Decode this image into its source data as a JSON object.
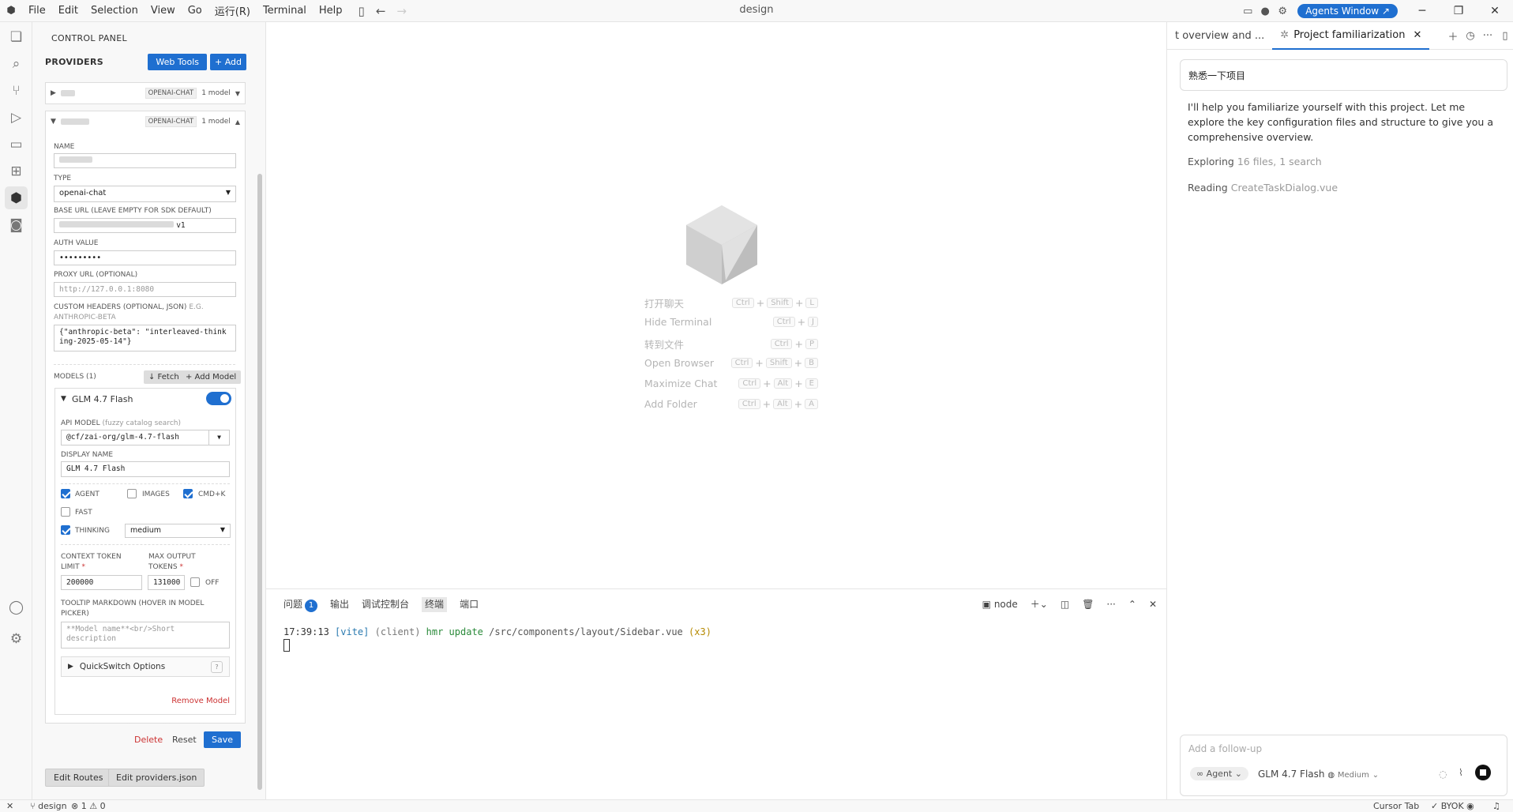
{
  "titlebar": {
    "menu": [
      "File",
      "Edit",
      "Selection",
      "View",
      "Go",
      "运行(R)",
      "Terminal",
      "Help"
    ],
    "title": "design",
    "agents_window": "Agents Window"
  },
  "panel": {
    "title": "CONTROL PANEL",
    "providers_title": "PROVIDERS",
    "web_tools": "Web Tools",
    "add": "+ Add",
    "provider1": {
      "type_tag": "OPENAI-CHAT",
      "count": "1 model"
    },
    "provider2": {
      "type_tag": "OPENAI-CHAT",
      "count": "1 model"
    },
    "name_label": "NAME",
    "type_label": "TYPE",
    "type_value": "openai-chat",
    "base_url_label": "BASE URL (LEAVE EMPTY FOR SDK DEFAULT)",
    "base_url_suffix": "v1",
    "auth_label": "AUTH VALUE",
    "auth_value": "•••••••••",
    "proxy_label": "PROXY URL (OPTIONAL)",
    "proxy_placeholder": "http://127.0.0.1:8080",
    "headers_label": "CUSTOM HEADERS (OPTIONAL, JSON)",
    "headers_hint": "E.G. ANTHROPIC-BETA",
    "headers_value": "{\"anthropic-beta\": \"interleaved-thinking-2025-05-14\"}",
    "models_label": "MODELS (1)",
    "fetch": "↓ Fetch",
    "add_model": "+ Add Model",
    "model": {
      "name": "GLM 4.7 Flash",
      "api_model_label": "API MODEL",
      "api_model_hint": "(fuzzy catalog search)",
      "api_model_value": "@cf/zai-org/glm-4.7-flash",
      "display_label": "DISPLAY NAME",
      "display_value": "GLM 4.7 Flash",
      "agent": "AGENT",
      "images": "IMAGES",
      "cmdk": "CMD+K",
      "fast": "FAST",
      "thinking": "THINKING",
      "thinking_value": "medium",
      "ctx_label1": "CONTEXT TOKEN",
      "ctx_label2": "LIMIT",
      "ctx_value": "200000",
      "max_label1": "MAX OUTPUT",
      "max_label2": "TOKENS",
      "max_value": "131000",
      "off": "OFF",
      "tooltip_label": "TOOLTIP MARKDOWN (HOVER IN MODEL PICKER)",
      "tooltip_placeholder": "**Model name**<br/>Short description",
      "quickswitch": "QuickSwitch Options",
      "remove": "Remove Model"
    },
    "delete": "Delete",
    "reset": "Reset",
    "save": "Save",
    "edit_routes": "Edit Routes",
    "edit_providers": "Edit providers.json"
  },
  "editor": {
    "shortcuts": [
      {
        "label": "打开聊天",
        "keys": [
          "Ctrl",
          "Shift",
          "L"
        ]
      },
      {
        "label": "Hide Terminal",
        "keys": [
          "Ctrl",
          "J"
        ]
      },
      {
        "label": "转到文件",
        "keys": [
          "Ctrl",
          "P"
        ]
      },
      {
        "label": "Open Browser",
        "keys": [
          "Ctrl",
          "Shift",
          "B"
        ]
      },
      {
        "label": "Maximize Chat",
        "keys": [
          "Ctrl",
          "Alt",
          "E"
        ]
      },
      {
        "label": "Add Folder",
        "keys": [
          "Ctrl",
          "Alt",
          "A"
        ]
      }
    ]
  },
  "terminal": {
    "tabs": [
      "问题",
      "输出",
      "调试控制台",
      "终端",
      "端口"
    ],
    "problems_count": "1",
    "shell": "node",
    "log": {
      "time": "17:39:13",
      "vite": "[vite]",
      "client": "(client)",
      "hmr": "hmr update",
      "path": "/src/components/layout/Sidebar.vue",
      "count": "(x3)"
    }
  },
  "chat": {
    "tab1": "t overview and ...",
    "tab2": "Project familiarization",
    "user_msg": "熟悉一下项目",
    "reply": "I'll help you familiarize yourself with this project. Let me explore the key configuration files and structure to give you a comprehensive overview.",
    "exploring": "Exploring",
    "exploring_detail": "16 files, 1 search",
    "reading": "Reading",
    "reading_file": "CreateTaskDialog.vue",
    "placeholder": "Add a follow-up",
    "mode": "Agent",
    "model": "GLM 4.7 Flash",
    "effort": "Medium"
  },
  "status": {
    "branch": "design",
    "errors": "1",
    "warnings": "0",
    "cursor_tab": "Cursor Tab",
    "byok": "BYOK"
  }
}
